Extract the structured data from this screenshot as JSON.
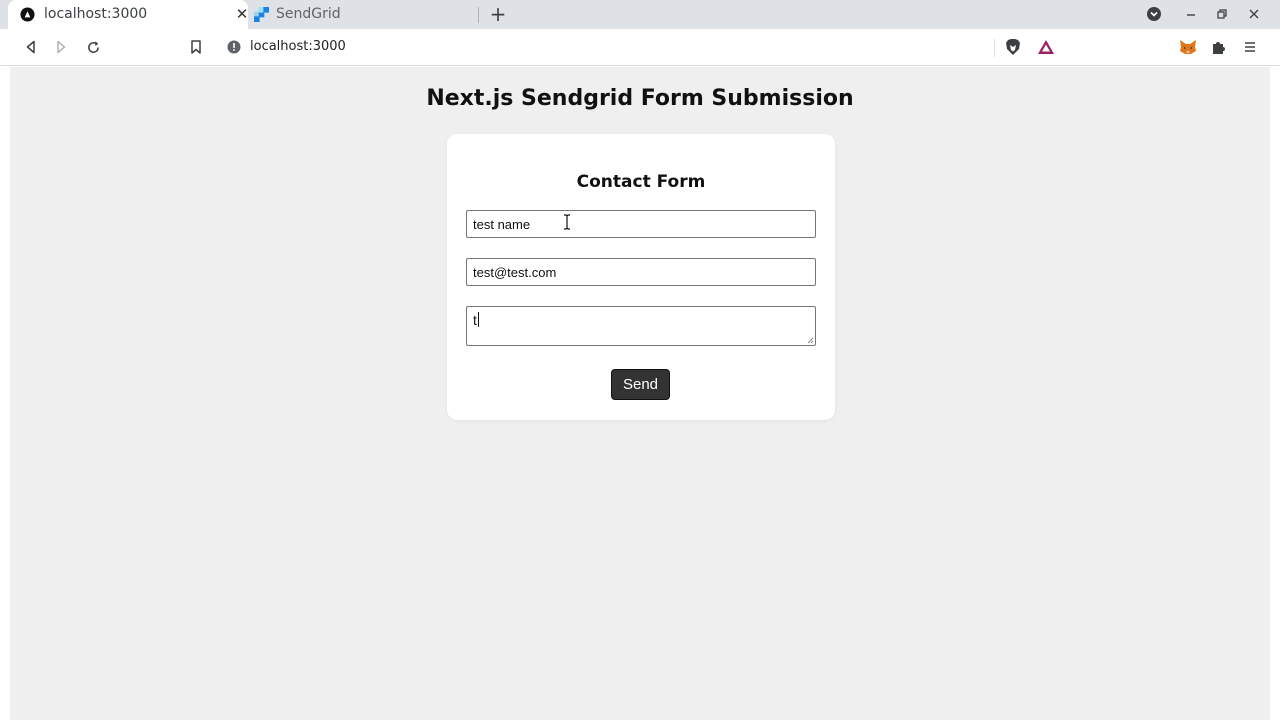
{
  "browser": {
    "tabs": [
      {
        "label": "localhost:3000",
        "active": true,
        "icon": "nextjs-icon"
      },
      {
        "label": "SendGrid",
        "active": false,
        "icon": "sendgrid-icon"
      }
    ],
    "address_bar": {
      "url": "localhost:3000"
    },
    "colors": {
      "tabstrip": "#dee1e6",
      "brave_shield": "#fb542b",
      "rewards": "#9e1f63"
    }
  },
  "page": {
    "title": "Next.js Sendgrid Form Submission",
    "form": {
      "title": "Contact Form",
      "name_value": "test name",
      "email_value": "test@test.com",
      "message_value": "t",
      "send_label": "Send"
    },
    "colors": {
      "background": "#efefef",
      "card": "#ffffff",
      "button": "#333333"
    }
  }
}
